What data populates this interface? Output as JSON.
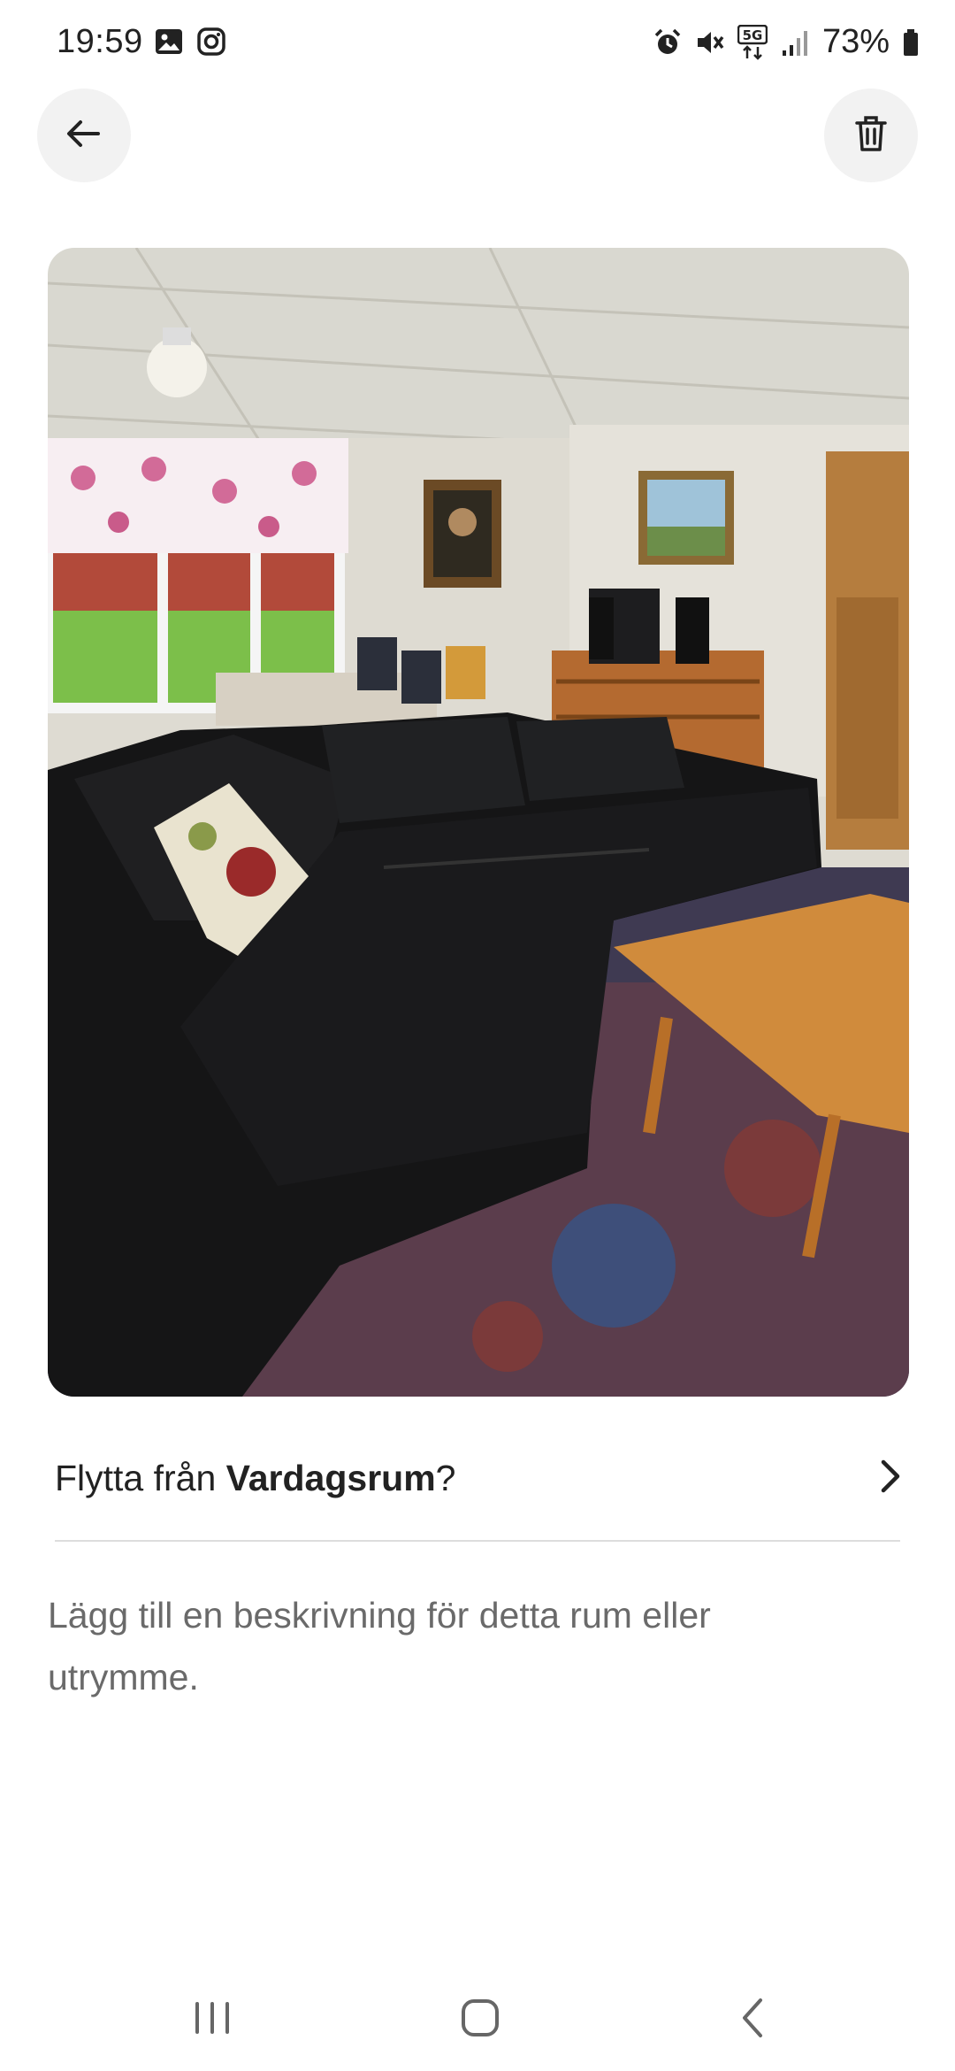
{
  "status_bar": {
    "time": "19:59",
    "battery": "73%",
    "network": "5G",
    "left_icons": [
      "gallery-icon",
      "instagram-icon"
    ],
    "right_icons": [
      "alarm-icon",
      "mute-icon",
      "5g-icon",
      "signal-icon",
      "battery-icon"
    ]
  },
  "header": {
    "back_icon": "arrow-left-icon",
    "delete_icon": "trash-icon"
  },
  "move": {
    "prefix": "Flytta från ",
    "room": "Vardagsrum",
    "suffix": "?"
  },
  "description_placeholder": "Lägg till en beskrivning för detta rum eller utrymme.",
  "nav": {
    "icons": [
      "recents-icon",
      "home-icon",
      "back-icon"
    ]
  },
  "colors": {
    "background": "#ffffff",
    "text_primary": "#222222",
    "text_secondary": "#6a6a6a",
    "divider": "#dddddd",
    "button_bg": "#f2f2f2"
  }
}
